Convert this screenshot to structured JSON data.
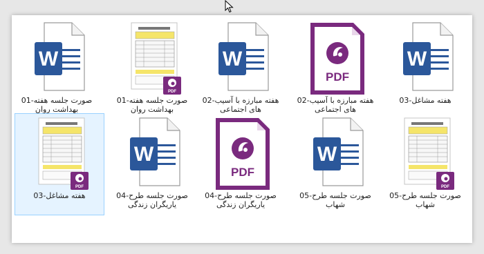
{
  "colors": {
    "word_blue": "#2b579a",
    "pdf_purple": "#7a2a7e",
    "selection": "#cce8ff"
  },
  "files": [
    {
      "label": "هفته مشاغل-03",
      "type": "word",
      "icon": "word-document-icon"
    },
    {
      "label": "هفته مبارزه با آسیب-02 های اجتماعی",
      "type": "pdf",
      "icon": "pdf-document-icon"
    },
    {
      "label": "هفته مبارزه با آسیب-02 های اجتماعی",
      "type": "word",
      "icon": "word-document-icon"
    },
    {
      "label": "صورت جلسه هفته-01 بهداشت روان",
      "type": "pdf-thumb",
      "icon": "pdf-thumbnail-icon"
    },
    {
      "label": "صورت جلسه هفته-01 بهداشت روان",
      "type": "word",
      "icon": "word-document-icon"
    },
    {
      "label": "صورت جلسه طرح-05 شهاب",
      "type": "pdf-thumb",
      "icon": "pdf-thumbnail-icon"
    },
    {
      "label": "صورت جلسه طرح-05 شهاب",
      "type": "word",
      "icon": "word-document-icon"
    },
    {
      "label": "صورت جلسه طرح-04 یاریگران زندگی",
      "type": "pdf",
      "icon": "pdf-document-icon"
    },
    {
      "label": "صورت جلسه طرح-04 یاریگران زندگی",
      "type": "word",
      "icon": "word-document-icon"
    },
    {
      "label": "هفته مشاغل-03",
      "type": "pdf-thumb",
      "icon": "pdf-thumbnail-icon",
      "selected": true
    }
  ],
  "badges": {
    "pdf": "PDF",
    "word": "W"
  }
}
